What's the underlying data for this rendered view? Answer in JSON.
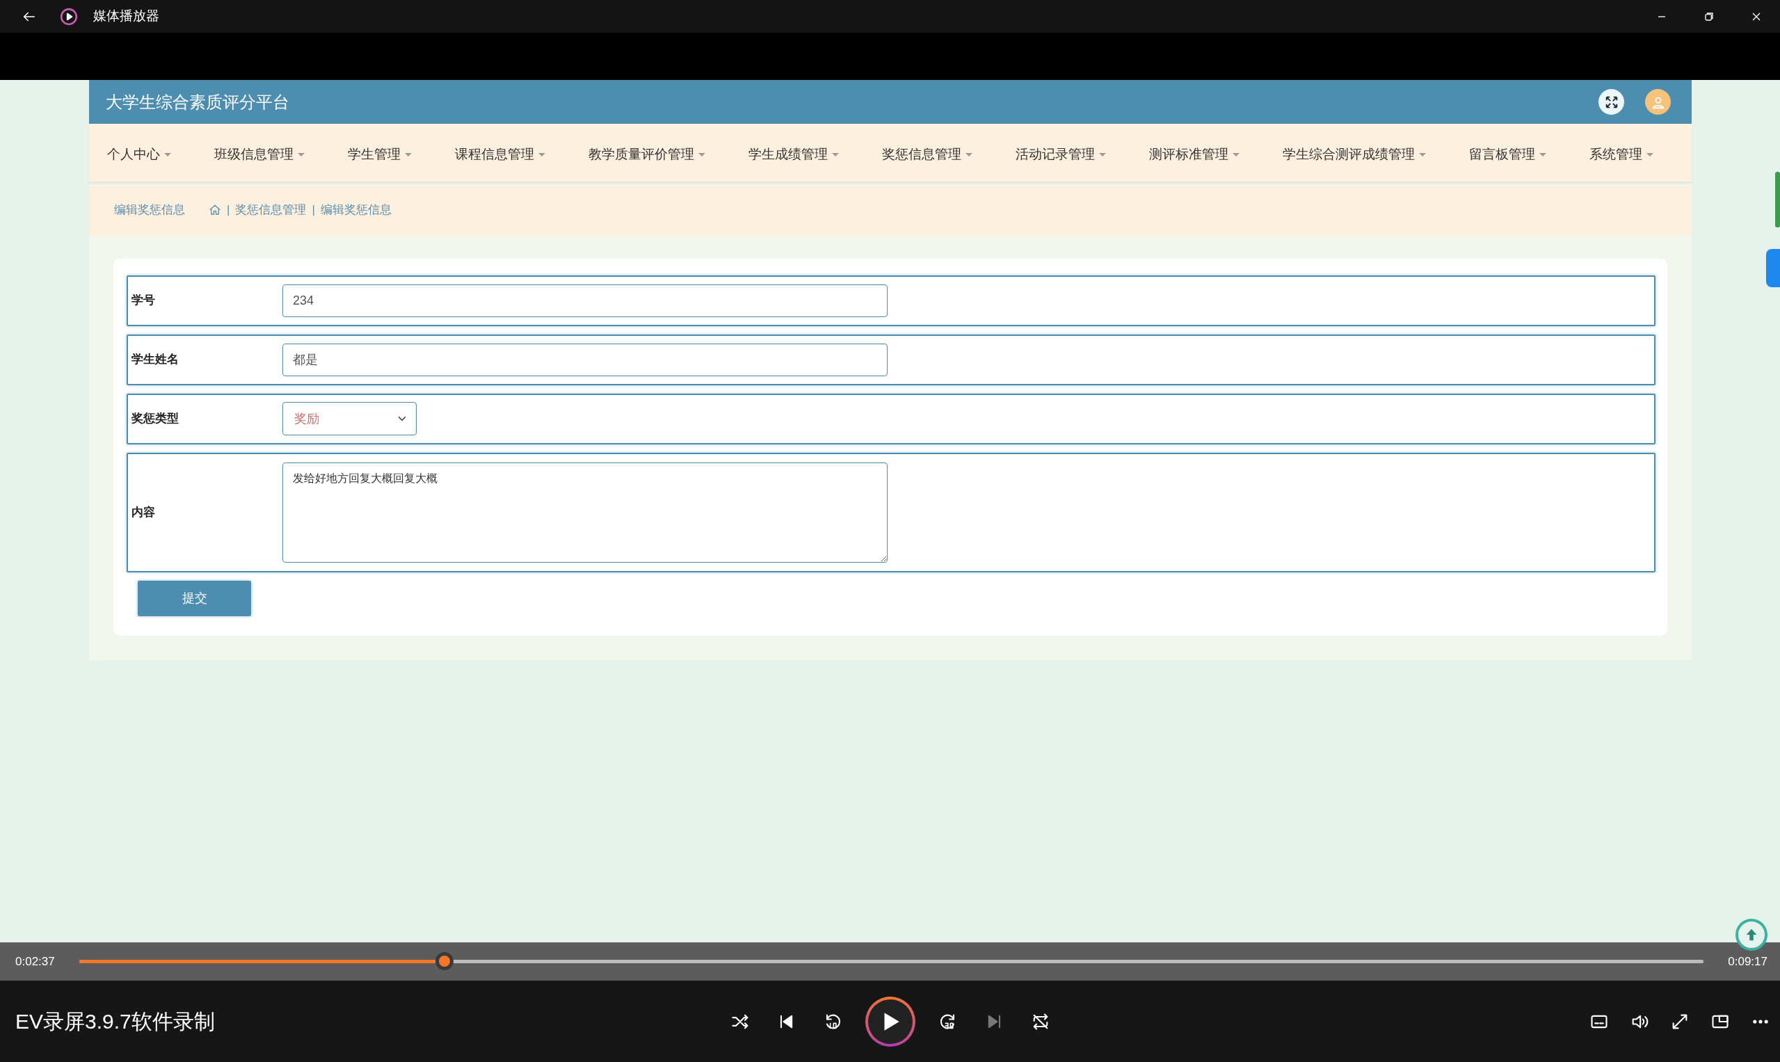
{
  "window": {
    "title": "媒体播放器"
  },
  "web_page": {
    "header": {
      "title": "大学生综合素质评分平台"
    },
    "nav_items": [
      {
        "label": "个人中心"
      },
      {
        "label": "班级信息管理"
      },
      {
        "label": "学生管理"
      },
      {
        "label": "课程信息管理"
      },
      {
        "label": "教学质量评价管理"
      },
      {
        "label": "学生成绩管理"
      },
      {
        "label": "奖惩信息管理"
      },
      {
        "label": "活动记录管理"
      },
      {
        "label": "测评标准管理"
      },
      {
        "label": "学生综合测评成绩管理"
      },
      {
        "label": "留言板管理"
      },
      {
        "label": "系统管理"
      }
    ],
    "breadcrumb": {
      "page_title": "编辑奖惩信息",
      "separator": "|",
      "path": [
        "奖惩信息管理",
        "编辑奖惩信息"
      ]
    },
    "form": {
      "fields": [
        {
          "kind": "input",
          "label": "学号",
          "value": "234"
        },
        {
          "kind": "input",
          "label": "学生姓名",
          "value": "都是"
        },
        {
          "kind": "select",
          "label": "奖惩类型",
          "value": "奖励"
        },
        {
          "kind": "textarea",
          "label": "内容",
          "value": "发给好地方回复大概回复大概"
        }
      ],
      "submit_label": "提交"
    }
  },
  "player": {
    "current_time": "0:02:37",
    "total_time": "0:09:17",
    "level": 0.224,
    "caption": "EV录屏3.9.7软件录制",
    "controls": [
      {
        "kind": "shuffle",
        "disabled": false
      },
      {
        "kind": "previous",
        "disabled": false
      },
      {
        "kind": "back10",
        "disabled": false
      },
      {
        "kind": "play",
        "disabled": false
      },
      {
        "kind": "forward30",
        "disabled": false
      },
      {
        "kind": "next",
        "disabled": true
      },
      {
        "kind": "repeat",
        "disabled": false
      }
    ],
    "extra_controls": [
      {
        "kind": "subtitles"
      },
      {
        "kind": "volume"
      },
      {
        "kind": "expand"
      },
      {
        "kind": "miniplayer"
      },
      {
        "kind": "more"
      }
    ]
  }
}
